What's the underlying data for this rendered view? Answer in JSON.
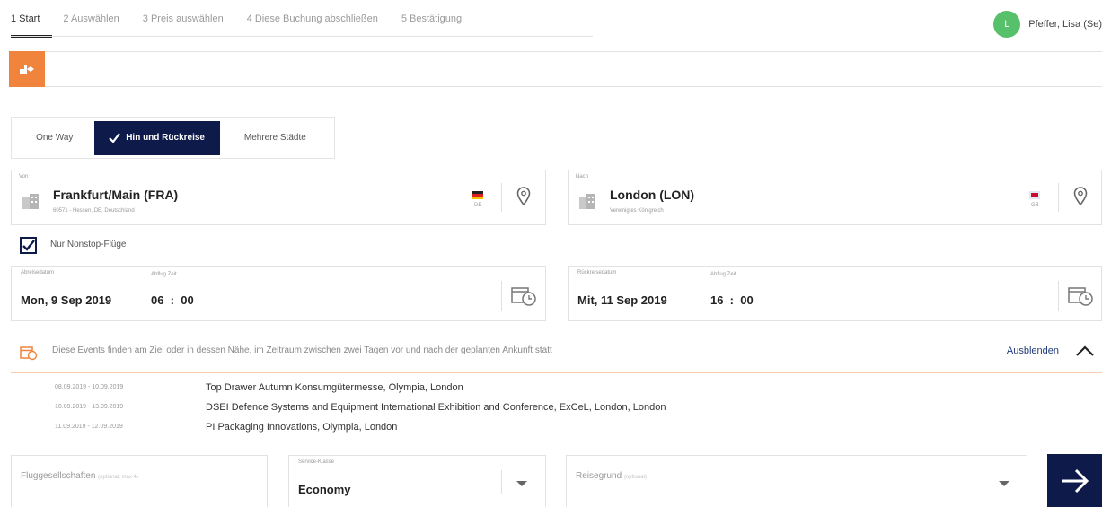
{
  "steps": [
    "1  Start",
    "2  Auswählen",
    "3  Preis auswählen",
    "4  Diese Buchung abschließen",
    "5  Bestätigung"
  ],
  "user": {
    "initial": "L",
    "name": "Pfeffer, Lisa (Se)"
  },
  "trip_type": {
    "one_way": "One Way",
    "round_trip": "Hin und Rückreise",
    "multi": "Mehrere Städte"
  },
  "origin": {
    "label": "Von",
    "city": "Frankfurt/Main (FRA)",
    "sub": "60571 - Hessen, DE, Deutschland",
    "flag_code": "DE"
  },
  "destination": {
    "label": "Nach",
    "city": "London (LON)",
    "sub": "Vereinigtes Königreich",
    "flag_code": "GB"
  },
  "nonstop": {
    "label": "Nur Nonstop-Flüge",
    "checked": true
  },
  "outbound": {
    "date_label": "Abreisedatum",
    "time_label": "Abflug Zeit",
    "date": "Mon, 9 Sep 2019",
    "time": "06  :  00"
  },
  "return": {
    "date_label": "Rückreisedatum",
    "time_label": "Abflug Zeit",
    "date": "Mit, 11 Sep 2019",
    "time": "16  :  00"
  },
  "events": {
    "notice": "Diese Events finden am Ziel oder in dessen Nähe, im Zeitraum zwischen zwei Tagen vor und nach der geplanten Ankunft statt",
    "hide_label": "Ausblenden",
    "items": [
      {
        "dates": "08.09.2019 - 10.09.2019",
        "name": "Top Drawer Autumn Konsumgütermesse, Olympia, London"
      },
      {
        "dates": "10.09.2019 - 13.09.2019",
        "name": "DSEI Defence Systems and Equipment International Exhibition and Conference, ExCeL, London, London"
      },
      {
        "dates": "11.09.2019 - 12.09.2019",
        "name": "PI Packaging Innovations, Olympia, London"
      }
    ]
  },
  "airlines": {
    "placeholder": "Fluggesellschaften",
    "hint": "(optional, max 4)"
  },
  "service_class": {
    "label": "Service-Klasse",
    "value": "Economy"
  },
  "reason": {
    "placeholder": "Reisegrund",
    "hint": "(optional)"
  },
  "colors": {
    "navy": "#0d1a4a",
    "orange": "#f0843c",
    "avatar_green": "#56c16a"
  }
}
